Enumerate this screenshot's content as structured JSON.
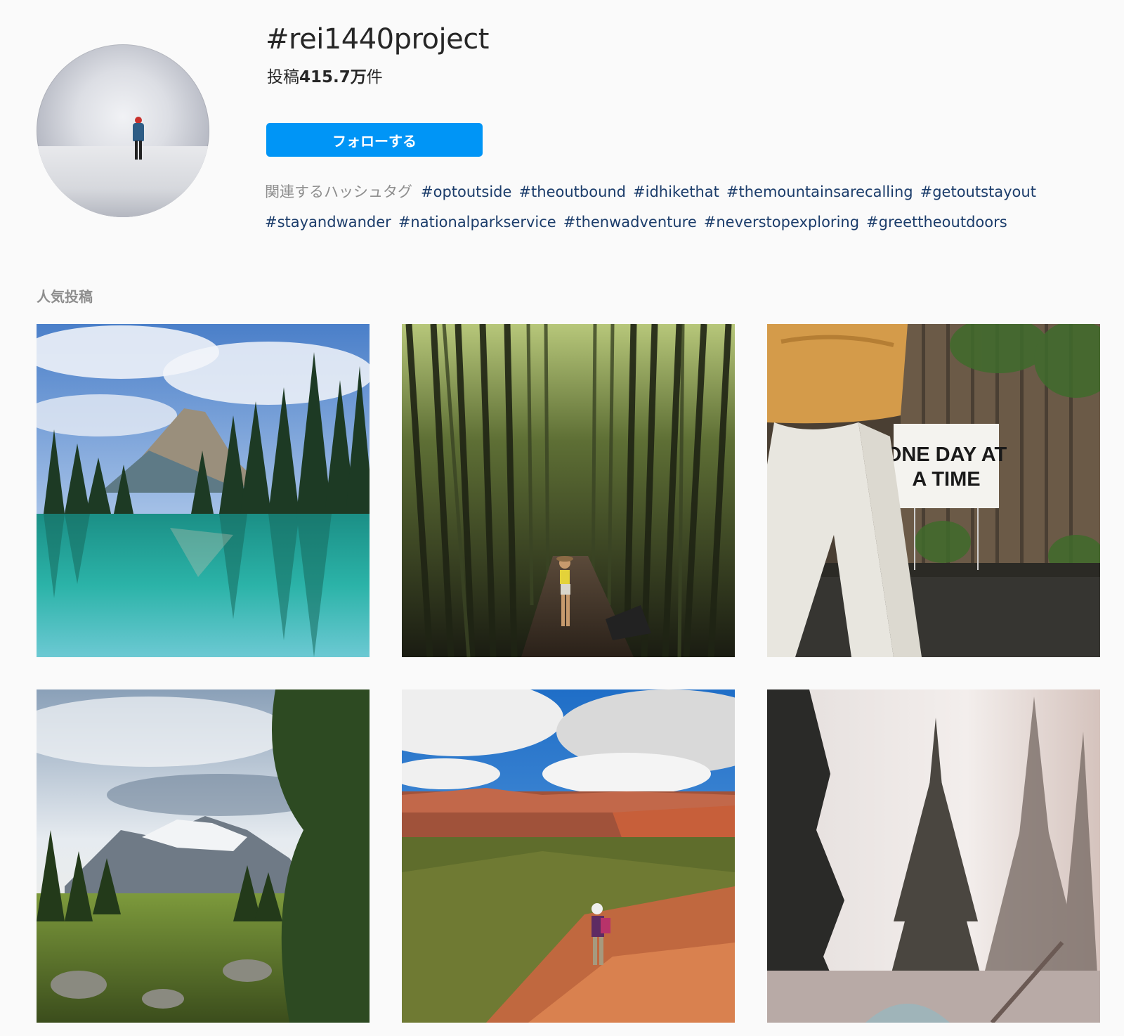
{
  "header": {
    "hashtag": "#rei1440project",
    "post_count_prefix": "投稿",
    "post_count_value": "415.7万",
    "post_count_suffix": "件",
    "follow_label": "フォローする"
  },
  "related": {
    "label": "関連するハッシュタグ",
    "tags": [
      "#optoutside",
      "#theoutbound",
      "#idhikethat",
      "#themountainsarecalling",
      "#getoutstayout",
      "#stayandwander",
      "#nationalparkservice",
      "#thenwadventure",
      "#neverstopexploring",
      "#greettheoutdoors"
    ]
  },
  "top_posts": {
    "title": "人気投稿",
    "posts": [
      {
        "name": "mountain-lake-photo"
      },
      {
        "name": "bamboo-forest-photo"
      },
      {
        "name": "one-day-at-a-time-photo",
        "sign_line1": "ONE DAY AT",
        "sign_line2": "A TIME"
      },
      {
        "name": "alpine-meadow-photo"
      },
      {
        "name": "red-rock-canyon-photo"
      },
      {
        "name": "misty-pine-forest-photo"
      }
    ]
  },
  "colors": {
    "accent": "#0095f6",
    "hashtag_link": "#1c3d6b",
    "muted_text": "#8e8e8e",
    "background": "#fafafa"
  }
}
